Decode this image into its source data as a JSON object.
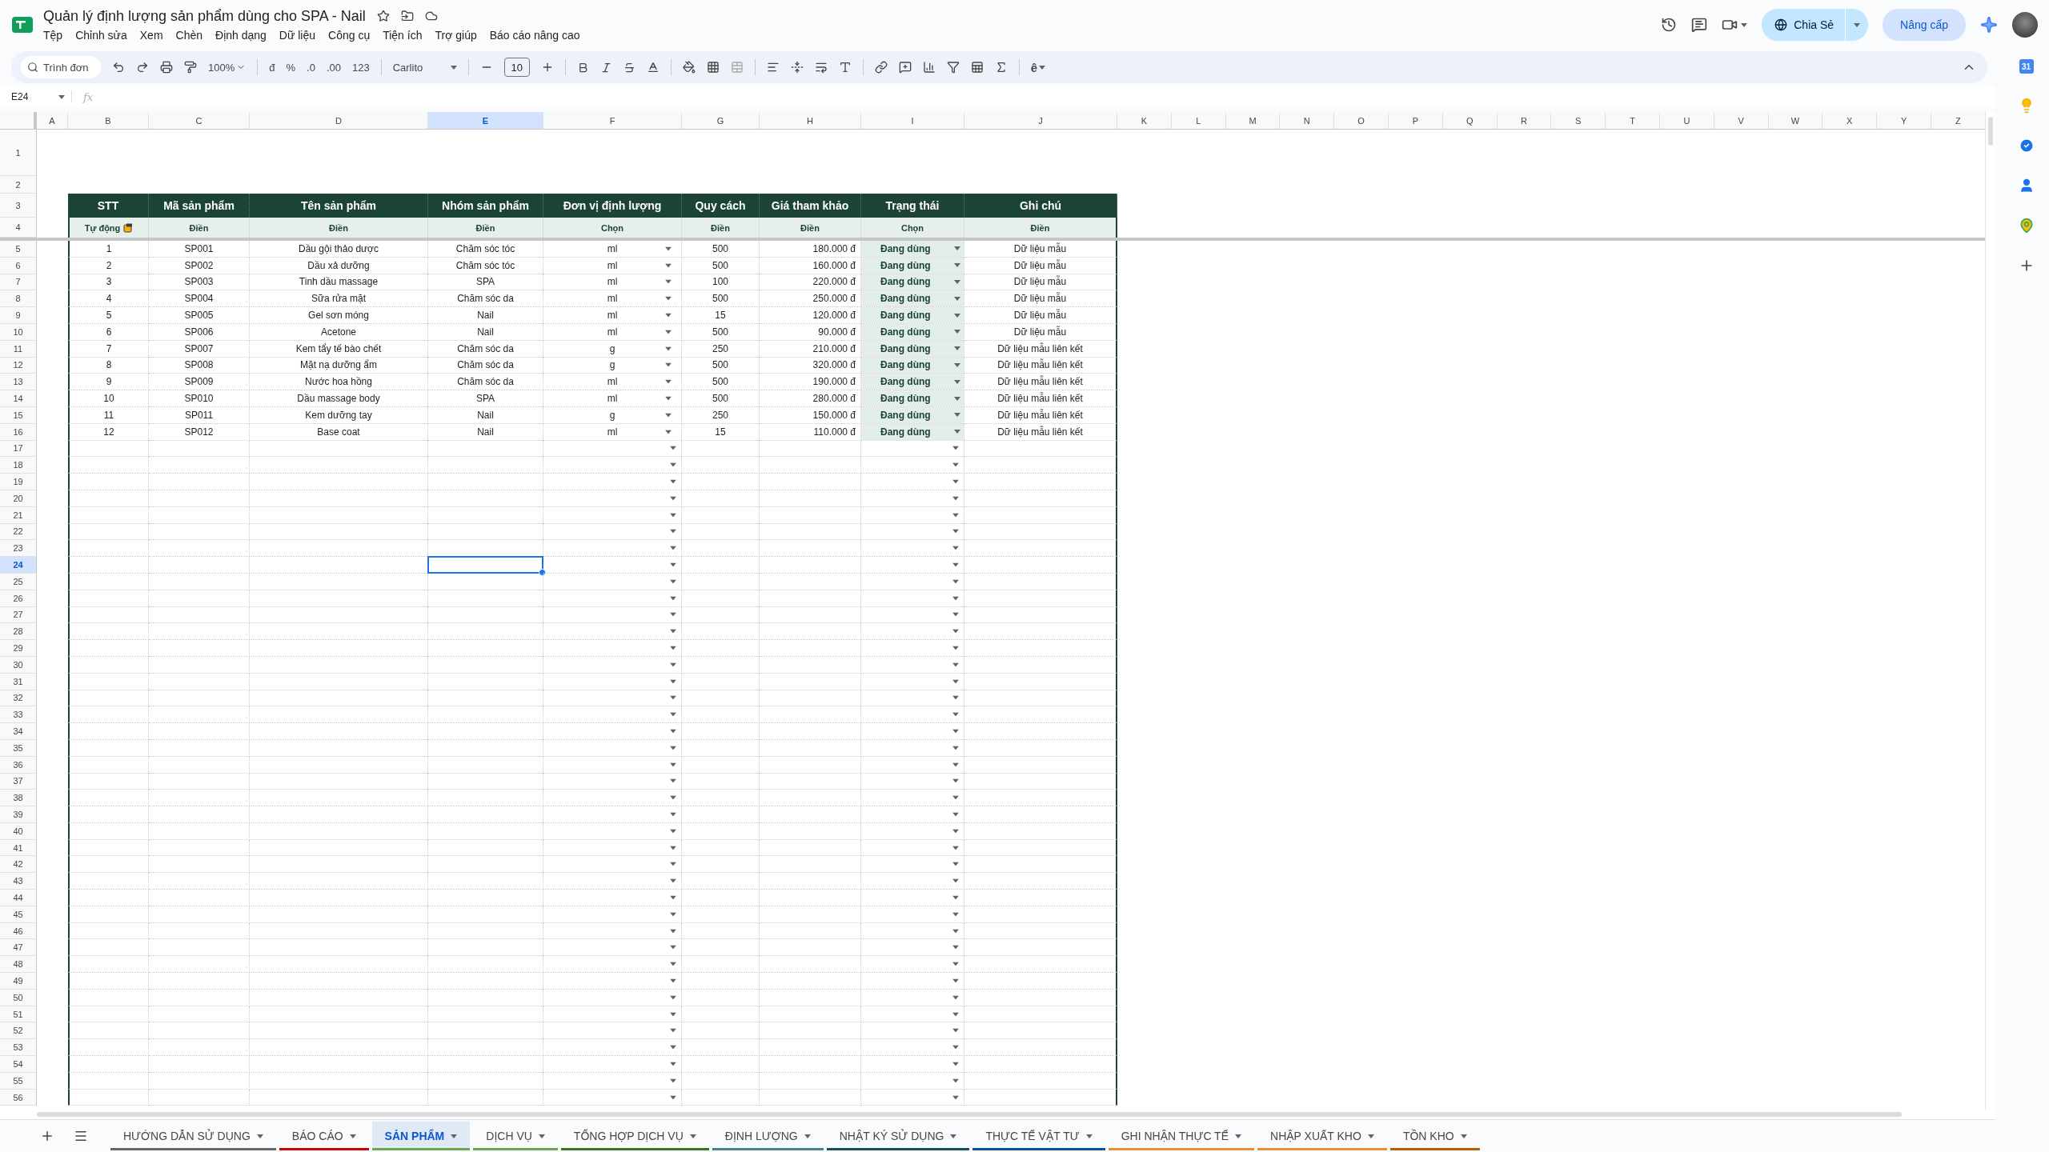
{
  "document": {
    "title": "Quản lý định lượng sản phẩm dùng cho SPA - Nail",
    "menu": [
      "Tệp",
      "Chỉnh sửa",
      "Xem",
      "Chèn",
      "Định dạng",
      "Dữ liệu",
      "Công cụ",
      "Tiện ích",
      "Trợ giúp",
      "Báo cáo nâng cao"
    ]
  },
  "header_actions": {
    "share": "Chia Sẻ",
    "upgrade": "Nâng cấp"
  },
  "toolbar": {
    "search_placeholder": "Trình đơn",
    "zoom": "100%",
    "currency": "đ",
    "percent": "%",
    "decrease_decimals": ".0",
    "increase_decimals": ".00",
    "number_format": "123",
    "font": "Carlito",
    "font_size": "10",
    "input_tools": "ê"
  },
  "formula_bar": {
    "name_box": "E24",
    "fx": "fx"
  },
  "side_panel": {
    "calendar_day": "31"
  },
  "columns": [
    {
      "label": "A",
      "selected": false
    },
    {
      "label": "B",
      "selected": false
    },
    {
      "label": "C",
      "selected": false
    },
    {
      "label": "D",
      "selected": false
    },
    {
      "label": "E",
      "selected": true
    },
    {
      "label": "F",
      "selected": false
    },
    {
      "label": "G",
      "selected": false
    },
    {
      "label": "H",
      "selected": false
    },
    {
      "label": "I",
      "selected": false
    },
    {
      "label": "J",
      "selected": false
    },
    {
      "label": "K",
      "selected": false
    },
    {
      "label": "L",
      "selected": false
    },
    {
      "label": "M",
      "selected": false
    },
    {
      "label": "N",
      "selected": false
    },
    {
      "label": "O",
      "selected": false
    },
    {
      "label": "P",
      "selected": false
    },
    {
      "label": "Q",
      "selected": false
    },
    {
      "label": "R",
      "selected": false
    },
    {
      "label": "S",
      "selected": false
    },
    {
      "label": "T",
      "selected": false
    },
    {
      "label": "U",
      "selected": false
    },
    {
      "label": "V",
      "selected": false
    },
    {
      "label": "W",
      "selected": false
    },
    {
      "label": "X",
      "selected": false
    },
    {
      "label": "Y",
      "selected": false
    },
    {
      "label": "Z",
      "selected": false
    }
  ],
  "rows": [
    {
      "label": "1",
      "selected": false
    },
    {
      "label": "2",
      "selected": false
    },
    {
      "label": "3",
      "selected": false
    },
    {
      "label": "4",
      "selected": false
    },
    {
      "label": "5",
      "selected": false
    },
    {
      "label": "6",
      "selected": false
    },
    {
      "label": "7",
      "selected": false
    },
    {
      "label": "8",
      "selected": false
    },
    {
      "label": "9",
      "selected": false
    },
    {
      "label": "10",
      "selected": false
    },
    {
      "label": "11",
      "selected": false
    },
    {
      "label": "12",
      "selected": false
    },
    {
      "label": "13",
      "selected": false
    },
    {
      "label": "14",
      "selected": false
    },
    {
      "label": "15",
      "selected": false
    },
    {
      "label": "16",
      "selected": false
    },
    {
      "label": "17",
      "selected": false
    },
    {
      "label": "18",
      "selected": false
    },
    {
      "label": "19",
      "selected": false
    },
    {
      "label": "20",
      "selected": false
    },
    {
      "label": "21",
      "selected": false
    },
    {
      "label": "22",
      "selected": false
    },
    {
      "label": "23",
      "selected": false
    },
    {
      "label": "24",
      "selected": true
    },
    {
      "label": "25",
      "selected": false
    },
    {
      "label": "26",
      "selected": false
    },
    {
      "label": "27",
      "selected": false
    },
    {
      "label": "28",
      "selected": false
    },
    {
      "label": "29",
      "selected": false
    },
    {
      "label": "30",
      "selected": false
    },
    {
      "label": "31",
      "selected": false
    },
    {
      "label": "32",
      "selected": false
    },
    {
      "label": "33",
      "selected": false
    },
    {
      "label": "34",
      "selected": false
    },
    {
      "label": "35",
      "selected": false
    },
    {
      "label": "36",
      "selected": false
    },
    {
      "label": "37",
      "selected": false
    },
    {
      "label": "38",
      "selected": false
    },
    {
      "label": "39",
      "selected": false
    },
    {
      "label": "40",
      "selected": false
    },
    {
      "label": "41",
      "selected": false
    },
    {
      "label": "42",
      "selected": false
    },
    {
      "label": "43",
      "selected": false
    },
    {
      "label": "44",
      "selected": false
    },
    {
      "label": "45",
      "selected": false
    },
    {
      "label": "46",
      "selected": false
    },
    {
      "label": "47",
      "selected": false
    },
    {
      "label": "48",
      "selected": false
    },
    {
      "label": "49",
      "selected": false
    },
    {
      "label": "50",
      "selected": false
    },
    {
      "label": "51",
      "selected": false
    },
    {
      "label": "52",
      "selected": false
    },
    {
      "label": "53",
      "selected": false
    },
    {
      "label": "54",
      "selected": false
    },
    {
      "label": "55",
      "selected": false
    },
    {
      "label": "56",
      "selected": false
    }
  ],
  "table": {
    "headers": [
      "STT",
      "Mã sản phẩm",
      "Tên sản phẩm",
      "Nhóm sản phẩm",
      "Đơn vị định lượng",
      "Quy cách",
      "Giá tham khảo",
      "Trạng thái",
      "Ghi chú"
    ],
    "hints": [
      {
        "text": "Tự động",
        "kind": "auto"
      },
      {
        "text": "Điền",
        "kind": "fill"
      },
      {
        "text": "Điền",
        "kind": "fill"
      },
      {
        "text": "Điền",
        "kind": "fill"
      },
      {
        "text": "Chọn",
        "kind": "choose"
      },
      {
        "text": "Điền",
        "kind": "fill"
      },
      {
        "text": "Điền",
        "kind": "fill"
      },
      {
        "text": "Chọn",
        "kind": "choose"
      },
      {
        "text": "Điền",
        "kind": "fill"
      }
    ],
    "records": [
      {
        "cells": [
          "1",
          "SP001",
          "Dầu gội thảo dược",
          "Chăm sóc tóc",
          "ml",
          "500",
          "180.000 đ",
          "Đang dùng",
          "Dữ liệu mẫu"
        ]
      },
      {
        "cells": [
          "2",
          "SP002",
          "Dầu xả dưỡng",
          "Chăm sóc tóc",
          "ml",
          "500",
          "160.000 đ",
          "Đang dùng",
          "Dữ liệu mẫu"
        ]
      },
      {
        "cells": [
          "3",
          "SP003",
          "Tinh dầu massage",
          "SPA",
          "ml",
          "100",
          "220.000 đ",
          "Đang dùng",
          "Dữ liệu mẫu"
        ]
      },
      {
        "cells": [
          "4",
          "SP004",
          "Sữa rửa mặt",
          "Chăm sóc da",
          "ml",
          "500",
          "250.000 đ",
          "Đang dùng",
          "Dữ liệu mẫu"
        ]
      },
      {
        "cells": [
          "5",
          "SP005",
          "Gel sơn móng",
          "Nail",
          "ml",
          "15",
          "120.000 đ",
          "Đang dùng",
          "Dữ liệu mẫu"
        ]
      },
      {
        "cells": [
          "6",
          "SP006",
          "Acetone",
          "Nail",
          "ml",
          "500",
          "90.000 đ",
          "Đang dùng",
          "Dữ liệu mẫu"
        ]
      },
      {
        "cells": [
          "7",
          "SP007",
          "Kem tẩy tế bào chết",
          "Chăm sóc da",
          "g",
          "250",
          "210.000 đ",
          "Đang dùng",
          "Dữ liệu mẫu liên kết"
        ]
      },
      {
        "cells": [
          "8",
          "SP008",
          "Mặt nạ dưỡng ẩm",
          "Chăm sóc da",
          "g",
          "500",
          "320.000 đ",
          "Đang dùng",
          "Dữ liệu mẫu liên kết"
        ]
      },
      {
        "cells": [
          "9",
          "SP009",
          "Nước hoa hồng",
          "Chăm sóc da",
          "ml",
          "500",
          "190.000 đ",
          "Đang dùng",
          "Dữ liệu mẫu liên kết"
        ]
      },
      {
        "cells": [
          "10",
          "SP010",
          "Dầu massage body",
          "SPA",
          "ml",
          "500",
          "280.000 đ",
          "Đang dùng",
          "Dữ liệu mẫu liên kết"
        ]
      },
      {
        "cells": [
          "11",
          "SP011",
          "Kem dưỡng tay",
          "Nail",
          "g",
          "250",
          "150.000 đ",
          "Đang dùng",
          "Dữ liệu mẫu liên kết"
        ]
      },
      {
        "cells": [
          "12",
          "SP012",
          "Base coat",
          "Nail",
          "ml",
          "15",
          "110.000 đ",
          "Đang dùng",
          "Dữ liệu mẫu liên kết"
        ]
      }
    ]
  },
  "sheet_tabs": [
    {
      "label": "HƯỚNG DẪN SỬ DỤNG",
      "color": "#666666",
      "selected": false
    },
    {
      "label": "BÁO CÁO",
      "color": "#cc0000",
      "selected": false
    },
    {
      "label": "SẢN PHẨM",
      "color": "#6aa84f",
      "selected": true
    },
    {
      "label": "DỊCH VỤ",
      "color": "#6aa84f",
      "selected": false
    },
    {
      "label": "TỔNG HỢP DỊCH VỤ",
      "color": "#38761d",
      "selected": false
    },
    {
      "label": "ĐỊNH LƯỢNG",
      "color": "#45818e",
      "selected": false
    },
    {
      "label": "NHẬT KÝ SỬ DỤNG",
      "color": "#134f5c",
      "selected": false
    },
    {
      "label": "THỰC TẾ VẬT TƯ",
      "color": "#0b5394",
      "selected": false
    },
    {
      "label": "GHI NHẬN THỰC TẾ",
      "color": "#e69138",
      "selected": false
    },
    {
      "label": "NHẬP XUẤT KHO",
      "color": "#e69138",
      "selected": false
    },
    {
      "label": "TỒN KHO",
      "color": "#b45f06",
      "selected": false
    }
  ]
}
